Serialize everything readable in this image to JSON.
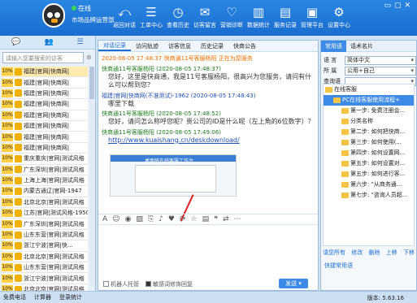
{
  "header": {
    "status": "在线",
    "org": "市场品牌运营部",
    "toolbar": [
      {
        "label": "返回对话",
        "icon": "return-icon"
      },
      {
        "label": "工单中心",
        "icon": "ticket-icon"
      },
      {
        "label": "查看历史",
        "icon": "history-icon"
      },
      {
        "label": "访客留言",
        "icon": "message-icon"
      },
      {
        "label": "营销诊断",
        "icon": "diagnosis-icon"
      },
      {
        "label": "数据统计",
        "icon": "stats-icon"
      },
      {
        "label": "服务记录",
        "icon": "record-icon"
      },
      {
        "label": "管理平台",
        "icon": "platform-icon"
      },
      {
        "label": "设置中心",
        "icon": "settings-icon"
      }
    ]
  },
  "left": {
    "tabs": [
      "💬",
      "👥",
      "☰"
    ],
    "search_placeholder": "请输入您要搜索的访客",
    "rows": [
      {
        "pct": "10%",
        "name": "福建|官网|快商网|",
        "sel": true
      },
      {
        "pct": "10%",
        "name": "福建|官网|快商网|"
      },
      {
        "pct": "10%",
        "name": "福建|官网|快商网|"
      },
      {
        "pct": "10%",
        "name": "福建|官网|快商网|"
      },
      {
        "pct": "10%",
        "name": "福建|官网|快商网|"
      },
      {
        "pct": "10%",
        "name": "福建|官网|快商网|"
      },
      {
        "pct": "10%",
        "name": "福建|官网|快商网|"
      },
      {
        "pct": "10%",
        "name": "福建|官网|快商网|"
      },
      {
        "pct": "10%",
        "name": "重庆重庆|官网|测试风格"
      },
      {
        "pct": "10%",
        "name": "广东深圳|官网|测试风格"
      },
      {
        "pct": "10%",
        "name": "上海上海|官网|测试风格"
      },
      {
        "pct": "10%",
        "name": "内蒙古通辽|官网-1947"
      },
      {
        "pct": "10%",
        "name": "北京北京|官网|测试风格"
      },
      {
        "pct": "10%",
        "name": "江苏|官网|测试风格-1950"
      },
      {
        "pct": "10%",
        "name": "广东深圳|官网|测试风格"
      },
      {
        "pct": "10%",
        "name": "山东东营|官网|测试风格"
      },
      {
        "pct": "10%",
        "name": "浙江宁波|官网|快..."
      },
      {
        "pct": "10%",
        "name": "北京北京|官网|测试风格"
      },
      {
        "pct": "10%",
        "name": "山东东营|官网|测试风格"
      },
      {
        "pct": "10%",
        "name": "浙江宁波|官网|测试风格"
      },
      {
        "pct": "10%",
        "name": "北京北京|官网|测试风格"
      },
      {
        "pct": "10%",
        "name": "北京北京|官网|测试风格"
      }
    ]
  },
  "mid": {
    "tabs": [
      "对话记录",
      "访问轨迹",
      "访客信息",
      "历史记录",
      "快商公告"
    ],
    "system": "2020-08-05 17:48:37 快商通11号客服杨阳 正在为您服务",
    "messages": [
      {
        "head": "快商通11号客服杨阳 (2020-08-05 17:48:37)",
        "text": "您好，这里是快商通，我是11号客服杨阳，很高兴为您服务，请问有什么可以帮到您？",
        "cust": false
      },
      {
        "head": "福建|官网|快商网(不准测试)-1962 (2020-08-05 17:48:43)",
        "text": "哪里下载",
        "cust": true
      },
      {
        "head": "快商通11号客服杨阳 (2020-08-05 17:48:52)",
        "text": "您好，请问怎么称呼您呢？贵公司的ID是什么呢（左上角的6位数字）？",
        "cust": false
      },
      {
        "head": "快商通11号客服杨阳 (2020-08-05 17:49:06)",
        "text": "http://www.kuaishang.cn/deskdownload/",
        "cust": false,
        "link": true
      }
    ],
    "preview_caption": "桌面版在线客服工作台",
    "robot_label": "机器人托管",
    "sensitive_label": "敏感词修饰回复",
    "send_label": "发送"
  },
  "right": {
    "tabs": [
      "常用语",
      "话术名片"
    ],
    "fields": [
      {
        "label": "语  言",
        "value": "简体中文"
      },
      {
        "label": "所  属",
        "value": "公用+自己"
      },
      {
        "label": "查询语",
        "value": ""
      }
    ],
    "tree": [
      {
        "text": "在线客服",
        "indent": 0
      },
      {
        "text": "PC在线客服使用流程+",
        "indent": 1,
        "sel": true
      },
      {
        "text": "第一步: 免费注册会...",
        "indent": 2
      },
      {
        "text": "分类名称",
        "indent": 2
      },
      {
        "text": "第二步: 如何把快商...",
        "indent": 2
      },
      {
        "text": "第三步: 如何使用(...",
        "indent": 2
      },
      {
        "text": "第四步: 如何设置网...",
        "indent": 2
      },
      {
        "text": "第五步: 如何设置对...",
        "indent": 2
      },
      {
        "text": "第五步: 如何进行客...",
        "indent": 2
      },
      {
        "text": "第六步: \"从商务通...",
        "indent": 2
      },
      {
        "text": "第七步: \"咨询人员超...",
        "indent": 2
      }
    ],
    "actions": [
      "请您所有",
      "修改",
      "删除",
      "上移",
      "下移"
    ],
    "bottom": "快捷常用语"
  },
  "statusbar": {
    "items": [
      "免费电话",
      "计算器",
      "登录统计"
    ],
    "version": "版本: 5.63.16"
  }
}
